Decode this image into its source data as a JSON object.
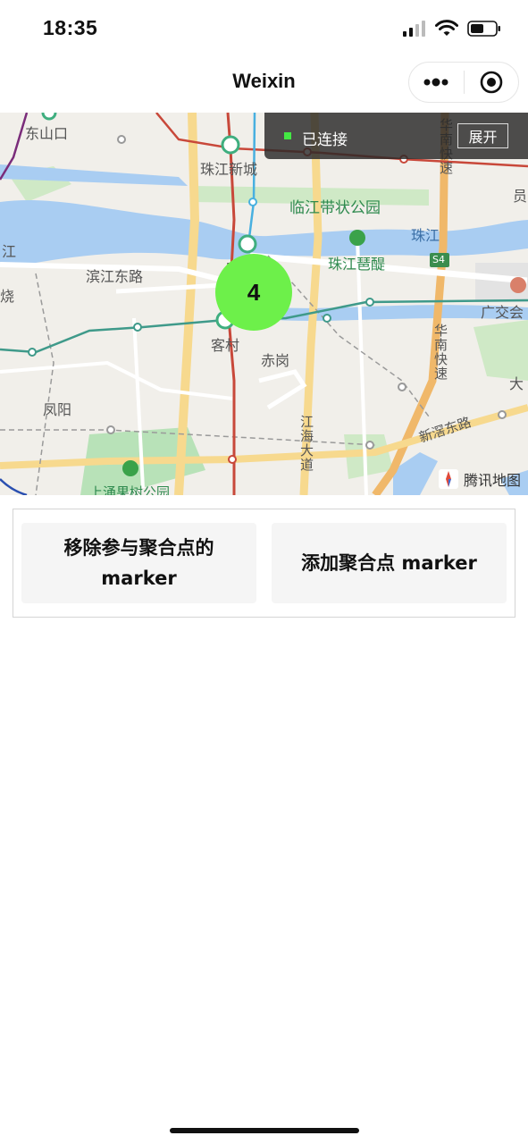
{
  "status_bar": {
    "time": "18:35",
    "icons": [
      "cellular-signal-icon",
      "wifi-icon",
      "battery-icon"
    ]
  },
  "nav": {
    "title": "Weixin",
    "more_icon": "more-dots-icon",
    "close_icon": "target-circle-icon"
  },
  "map": {
    "cluster_count": "4",
    "connection_status": "已连接",
    "expand_label": "展开",
    "attribution": "腾讯地图",
    "labels": {
      "dongshankou": "东山口",
      "zhujiang_new_town": "珠江新城",
      "linjiang_park": "临江带状公园",
      "zhujiang": "珠江",
      "zhujiang_qiqi": "珠江琶醍",
      "binjiang_east": "滨江东路",
      "kecun": "客村",
      "chigang": "赤岗",
      "fengyang": "凤阳",
      "jianghai_avenue": "江海大道",
      "huanan_expressway_top": "华南快速",
      "huanan_expressway_mid": "华南快速",
      "xinjiao_east": "新滘东路",
      "guangjiao": "广交会",
      "shangchong_park": "上涌果树公园",
      "s4": "S4",
      "left_edge_1": "江",
      "left_edge_2": "烧",
      "right_edge_1": "员",
      "right_edge_2": "大",
      "kecun_top": "广"
    },
    "colors": {
      "water": "#a9cdf2",
      "green": "#b8e2b8",
      "road_yellow": "#f7d98e",
      "metro_red": "#c8483a",
      "metro_teal": "#3f9a8a",
      "metro_blue": "#48b0e0",
      "cluster": "#6df04a"
    }
  },
  "buttons": {
    "remove_label": "移除参与聚合点的 marker",
    "add_label": "添加聚合点 marker"
  }
}
